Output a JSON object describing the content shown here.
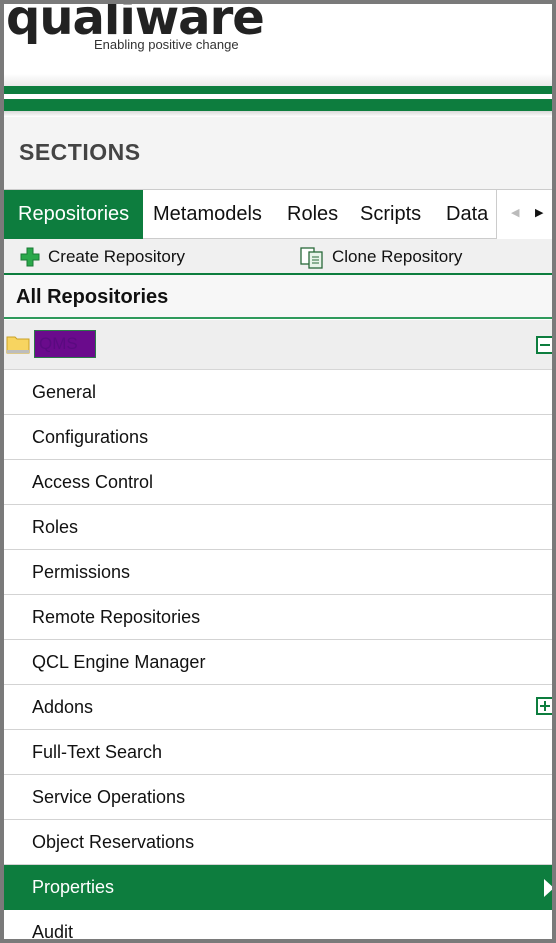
{
  "header": {
    "logo_text": "qualiware",
    "tagline": "Enabling positive change"
  },
  "sections": {
    "title": "SECTIONS"
  },
  "tabs": [
    {
      "label": "Repositories",
      "active": true
    },
    {
      "label": "Metamodels",
      "active": false
    },
    {
      "label": "Roles",
      "active": false
    },
    {
      "label": "Scripts",
      "active": false
    },
    {
      "label": "Data",
      "active": false
    }
  ],
  "tab_scroll": {
    "left": "◀",
    "right": "▶"
  },
  "toolbar": {
    "create_label": "Create Repository",
    "clone_label": "Clone Repository"
  },
  "tree": {
    "heading": "All Repositories",
    "repo_name": "QMS"
  },
  "menu": {
    "items": [
      {
        "label": "General"
      },
      {
        "label": "Configurations"
      },
      {
        "label": "Access Control"
      },
      {
        "label": "Roles"
      },
      {
        "label": "Permissions"
      },
      {
        "label": "Remote Repositories"
      },
      {
        "label": "QCL Engine Manager"
      },
      {
        "label": "Addons",
        "expandable": true
      },
      {
        "label": "Full-Text Search"
      },
      {
        "label": "Service Operations"
      },
      {
        "label": "Object Reservations"
      },
      {
        "label": "Properties",
        "active": true
      },
      {
        "label": "Audit"
      }
    ]
  },
  "colors": {
    "brand_green": "#0d7d3e",
    "repo_highlight": "#6a0b8c"
  }
}
